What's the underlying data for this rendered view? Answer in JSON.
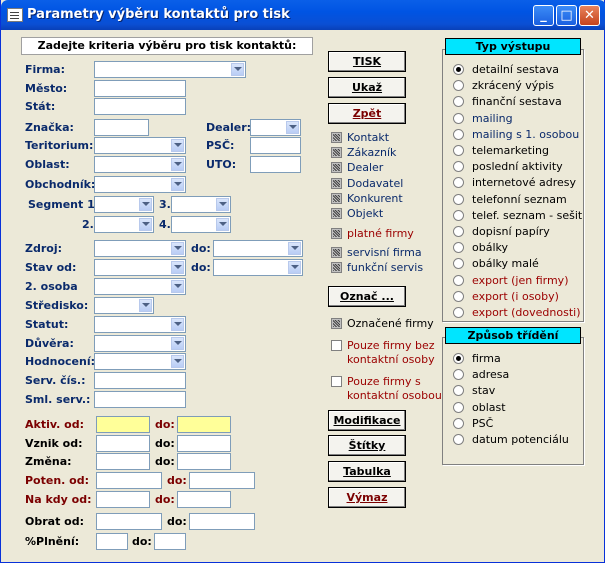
{
  "window": {
    "title": "Parametry výběru kontaktů pro tisk",
    "min": "_",
    "max": "□",
    "close": "✕"
  },
  "header": "Zadejte kriteria výběru pro tisk kontaktů:",
  "labels": {
    "firma": "Firma:",
    "mesto": "Město:",
    "stat": "Stát:",
    "znacka": "Značka:",
    "dealer": "Dealer:",
    "teritorium": "Teritorium:",
    "psc": "PSČ:",
    "oblast": "Oblast:",
    "uto": "UTO:",
    "obchodnik": "Obchodník:",
    "segment1": "Segment 1.",
    "s3": "3.",
    "s2": "2.",
    "s4": "4.",
    "zdroj": "Zdroj:",
    "do1": "do:",
    "stavod": "Stav od:",
    "do2": "do:",
    "osoba2": "2. osoba",
    "stredisko": "Středisko:",
    "statut": "Statut:",
    "duvera": "Důvěra:",
    "hodnoceni": "Hodnocení:",
    "servcis": "Serv. čís.:",
    "smlserv": "Sml. serv.:",
    "aktivod": "Aktiv. od:",
    "aktivdo": "do:",
    "vznikod": "Vznik od:",
    "vznikdo": "do:",
    "zmena": "Změna:",
    "zmenado": "do:",
    "potenod": "Poten. od:",
    "potendo": "do:",
    "nakdyod": "Na kdy od:",
    "nakdydo": "do:",
    "obratod": "Obrat od:",
    "obratdo": "do:",
    "plneni": "%Plnění:",
    "plnenido": "do:"
  },
  "buttons": {
    "tisk": "TISK",
    "ukaz": "Ukaž",
    "zpet": "Zpět",
    "oznac": "Označ ...",
    "modifikace": "Modifikace",
    "stitky": "Štítky",
    "tabulka": "Tabulka",
    "vymaz": "Výmaz"
  },
  "checks": {
    "kontakt": "Kontakt",
    "zakaznik": "Zákazník",
    "dealer": "Dealer",
    "dodavatel": "Dodavatel",
    "konkurent": "Konkurent",
    "objekt": "Objekt",
    "platne": "platné firmy",
    "servisni": "servisní firma",
    "funkcni": "funkční servis",
    "oznacene": "Označené firmy",
    "bezkontaktni1": "Pouze firmy bez",
    "bezkontaktni2": "kontaktní osoby",
    "skontaktni1": "Pouze firmy s",
    "skontaktni2": "kontaktní osobou"
  },
  "vystup": {
    "title": "Typ výstupu",
    "options": [
      "detailní sestava",
      "zkrácený výpis",
      "finanční sestava",
      "mailing",
      "mailing s 1. osobou",
      "telemarketing",
      "poslední aktivity",
      "internetové adresy",
      "telefonní seznam",
      "telef. seznam - sešit",
      "dopisní papíry",
      "obálky",
      "obálky malé",
      "export (jen firmy)",
      "export (i osoby)",
      "export (dovednosti)"
    ],
    "selected": "detailní sestava"
  },
  "trideni": {
    "title": "Způsob třídění",
    "options": [
      "firma",
      "adresa",
      "stav",
      "oblast",
      "PSČ",
      "datum potenciálu"
    ],
    "selected": "firma"
  }
}
